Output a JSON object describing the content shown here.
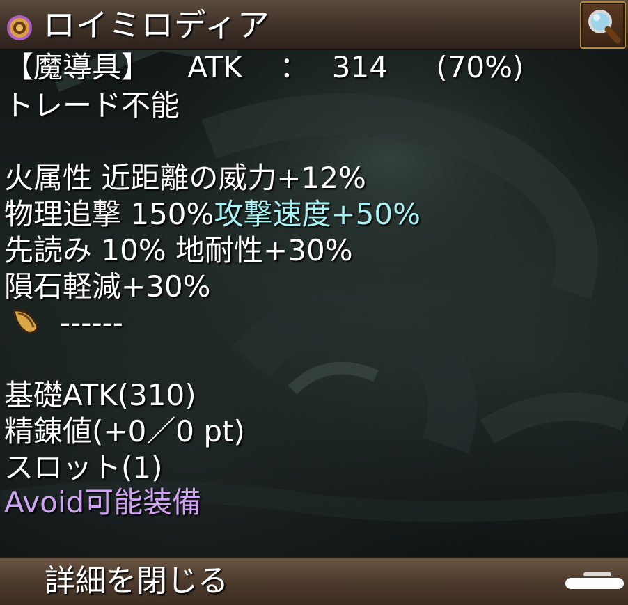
{
  "item": {
    "name": "ロイミロディア",
    "name_icon": "purple-ring-gem-icon",
    "search_icon": "magnifier-icon"
  },
  "stats": {
    "category": "【魔導具】",
    "atk_label": "ATK",
    "atk_sep": "：",
    "atk_value": "314",
    "atk_percent": "(70%)",
    "trade": "トレード不能"
  },
  "effects": {
    "line1": "火属性 近距離の威力+12%",
    "line2_a": "物理追撃 150% ",
    "line2_b": "攻撃速度+50%",
    "line3": "先読み 10% 地耐性+30%",
    "line4": "隕石軽減+30%",
    "card_slot": "------",
    "card_icon": "seed-card-icon"
  },
  "details": {
    "base_atk": "基礎ATK(310)",
    "refine": "精錬値(+0／0 pt)",
    "slot": "スロット(1)",
    "avoid": "Avoid可能装備"
  },
  "footer": {
    "close_label": "詳細を閉じる"
  },
  "colors": {
    "highlight_cyan": "#a6f2f4",
    "highlight_purple": "#cfa2f2",
    "bar_brown": "#4d3b2d"
  }
}
